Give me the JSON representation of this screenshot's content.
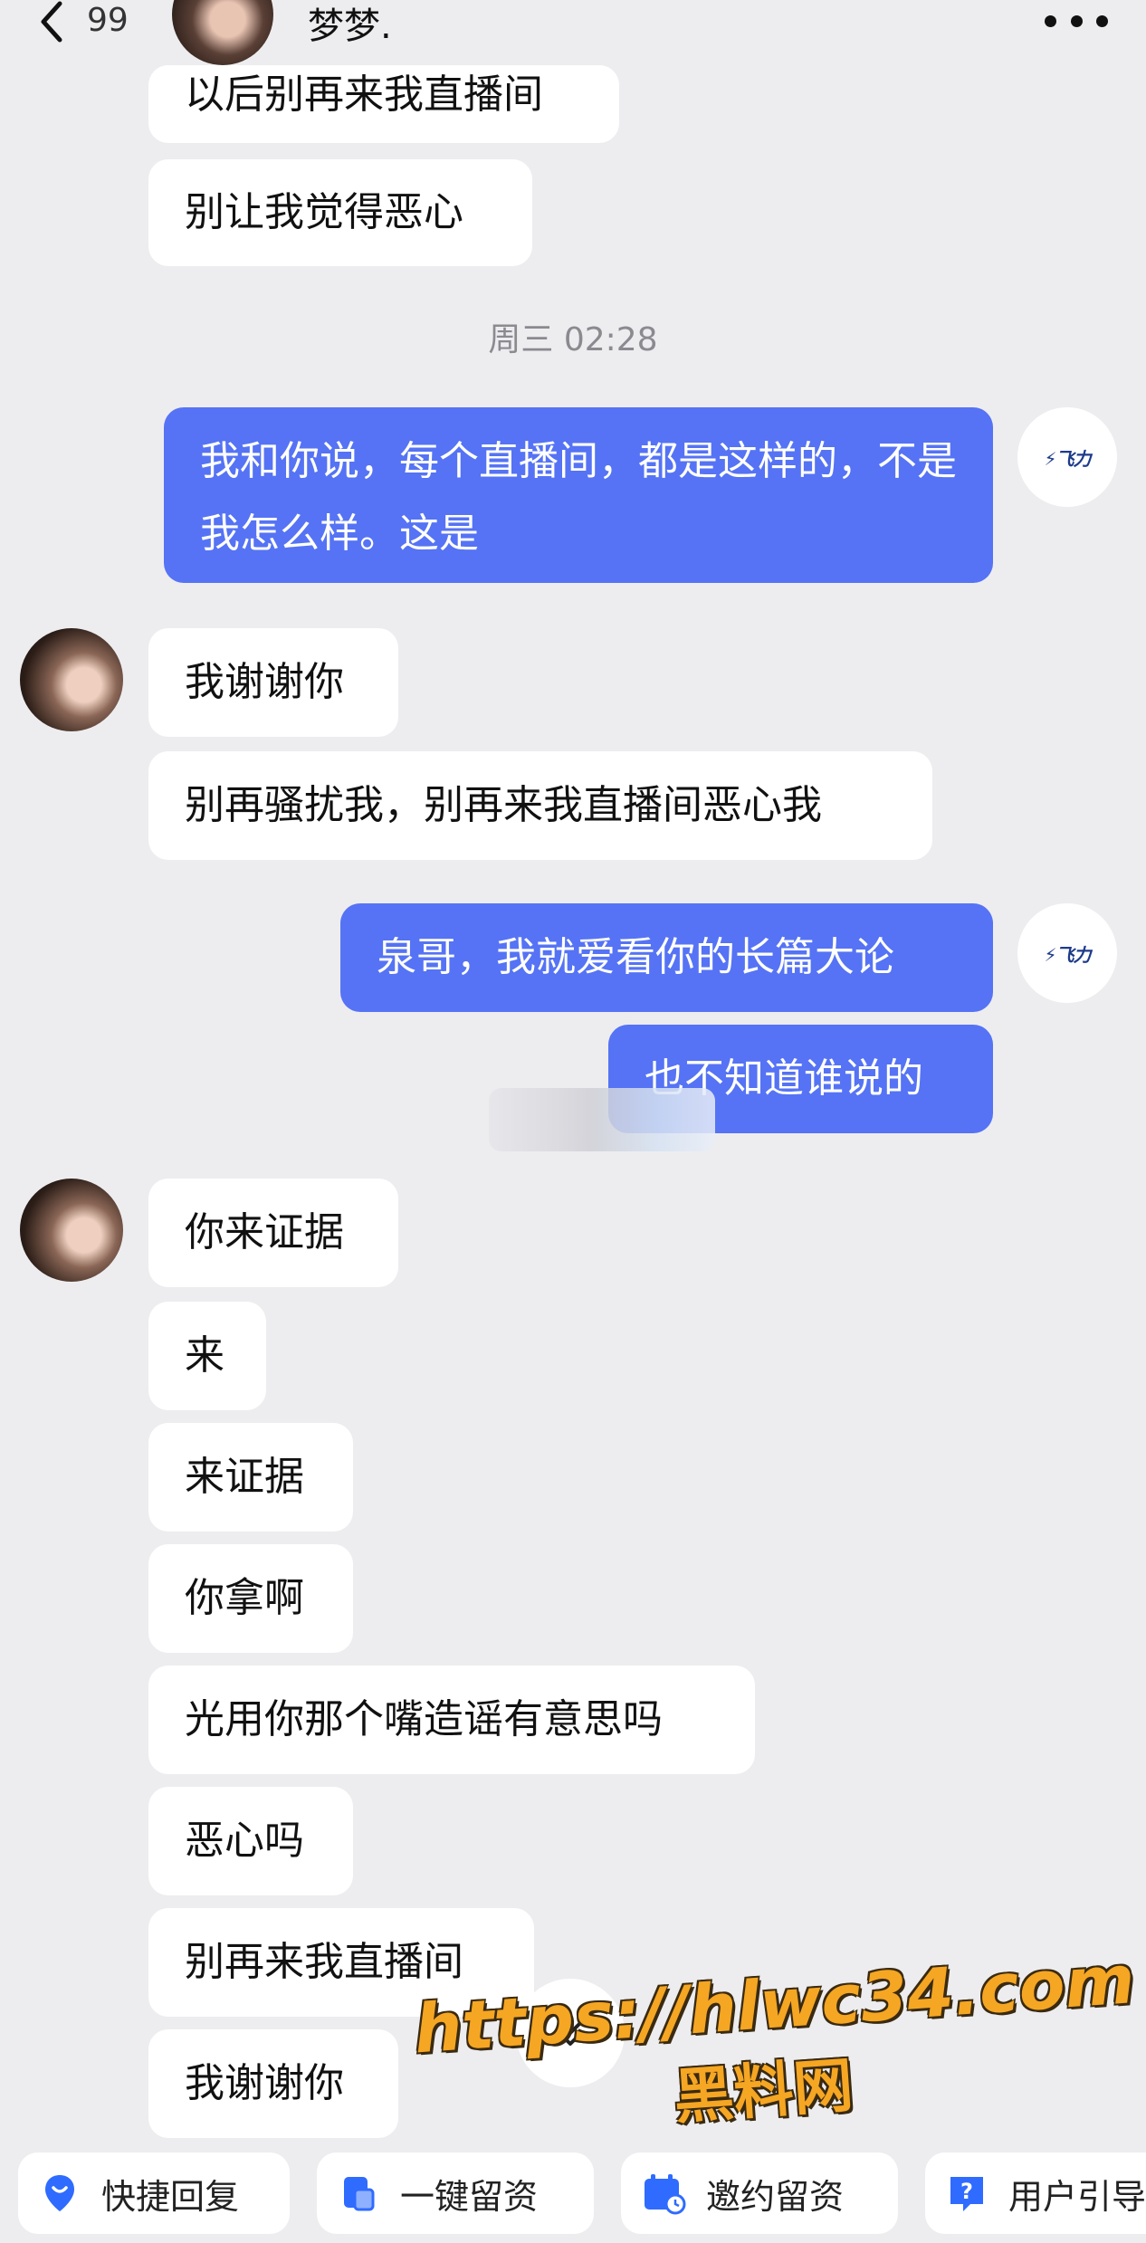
{
  "header": {
    "back_icon": "chevron-left-icon",
    "unread_count": "99",
    "contact_name": "梦梦.",
    "more_icon": "more-dots-icon"
  },
  "timestamp": "周三 02:28",
  "messages": [
    {
      "side": "in",
      "text": "以后别再来我直播间"
    },
    {
      "side": "in",
      "text": "别让我觉得恶心"
    },
    {
      "side": "out",
      "text": "我和你说，每个直播间，都是这样的，不是我怎么样。这是"
    },
    {
      "side": "in",
      "text": "我谢谢你"
    },
    {
      "side": "in",
      "text": "别再骚扰我，别再来我直播间恶心我"
    },
    {
      "side": "out",
      "text": "泉哥，我就爱看你的长篇大论"
    },
    {
      "side": "out",
      "text": "也不知道谁说的"
    },
    {
      "side": "in",
      "text": "你来证据"
    },
    {
      "side": "in",
      "text": "来"
    },
    {
      "side": "in",
      "text": "来证据"
    },
    {
      "side": "in",
      "text": "你拿啊"
    },
    {
      "side": "in",
      "text": "光用你那个嘴造谣有意思吗"
    },
    {
      "side": "in",
      "text": "恶心吗"
    },
    {
      "side": "in",
      "text": "别再来我直播间"
    },
    {
      "side": "in",
      "text": "我谢谢你"
    }
  ],
  "watermark": {
    "url": "https://hlwc34.com",
    "site": "黑料网"
  },
  "quick_actions": [
    {
      "label": "快捷回复",
      "icon": "location-pin-icon"
    },
    {
      "label": "一键留资",
      "icon": "clipboard-icon"
    },
    {
      "label": "邀约留资",
      "icon": "calendar-icon"
    },
    {
      "label": "用户引导",
      "icon": "help-icon"
    }
  ],
  "colors": {
    "background": "#ededf0",
    "outgoing_bubble": "#5573f4",
    "incoming_bubble": "#ffffff",
    "accent": "#2f6bff"
  }
}
